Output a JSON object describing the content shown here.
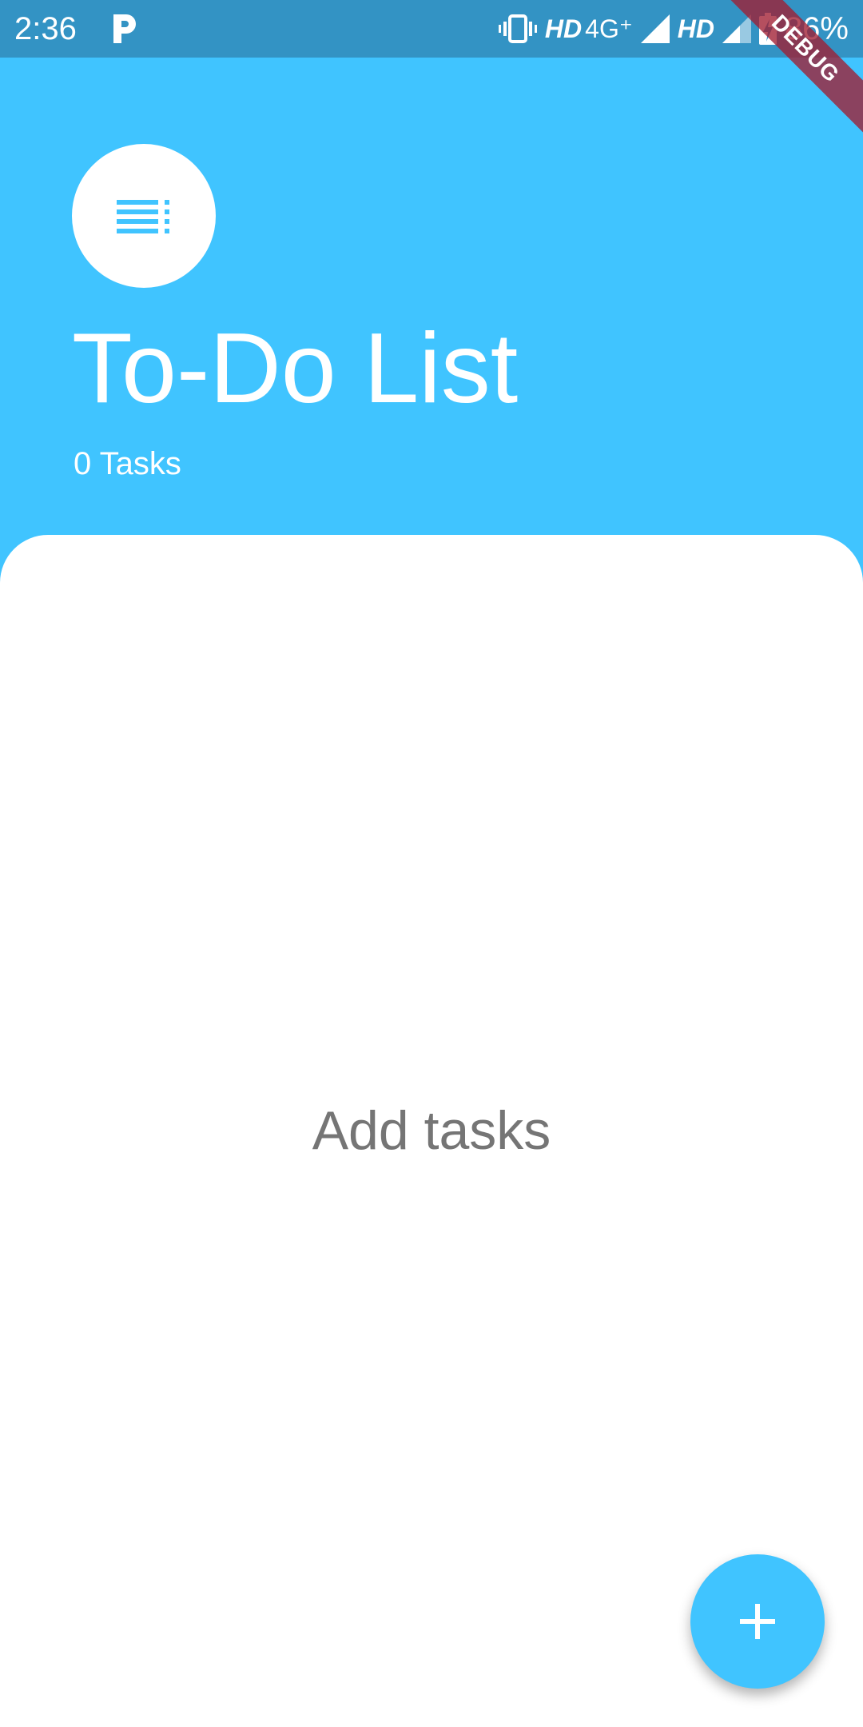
{
  "status_bar": {
    "time": "2:36",
    "network_hd_1": "HD",
    "network_type": "4G⁺",
    "network_hd_2": "HD",
    "battery_percent": "86%",
    "icons": [
      "parking-app-icon",
      "vibrate-icon",
      "signal-icon",
      "signal-icon",
      "battery-charging-icon"
    ]
  },
  "debug_banner": "DEBUG",
  "header": {
    "menu_icon": "list-menu-icon",
    "title": "To-Do List",
    "task_count": "0 Tasks"
  },
  "content": {
    "empty_message": "Add tasks"
  },
  "fab": {
    "icon": "add-icon"
  },
  "colors": {
    "accent": "#40c4ff",
    "status_bar": "#3393c4",
    "empty_text": "#757575",
    "card": "#ffffff"
  }
}
